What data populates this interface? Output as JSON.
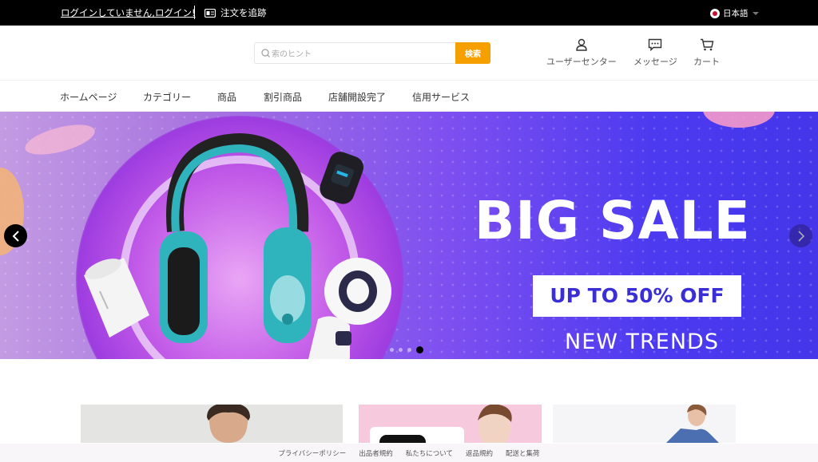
{
  "topbar": {
    "login_link": "ログインしていません,ログイン!",
    "track_order": "注文を追跡",
    "language": "日本語"
  },
  "header": {
    "search_placeholder": "索のヒント",
    "search_button": "検索",
    "user_center": "ユーザーセンター",
    "messages": "メッセージ",
    "cart": "カート"
  },
  "nav": {
    "items": [
      "ホームページ",
      "カテゴリー",
      "商品",
      "割引商品",
      "店舗開設完了",
      "信用サービス"
    ]
  },
  "banner": {
    "headline": "BIG SALE",
    "offer": "UP TO 50% OFF",
    "tagline": "NEW TRENDS",
    "slide_count": 4,
    "active_slide": 4
  },
  "footer": {
    "links": [
      "プライバシーポリシー",
      "出品者規約",
      "私たちについて",
      "返品規約",
      "配送と集荷"
    ]
  },
  "colors": {
    "accent": "#f5a000",
    "topbar_bg": "#000000",
    "banner_text": "#3a2fd6"
  }
}
